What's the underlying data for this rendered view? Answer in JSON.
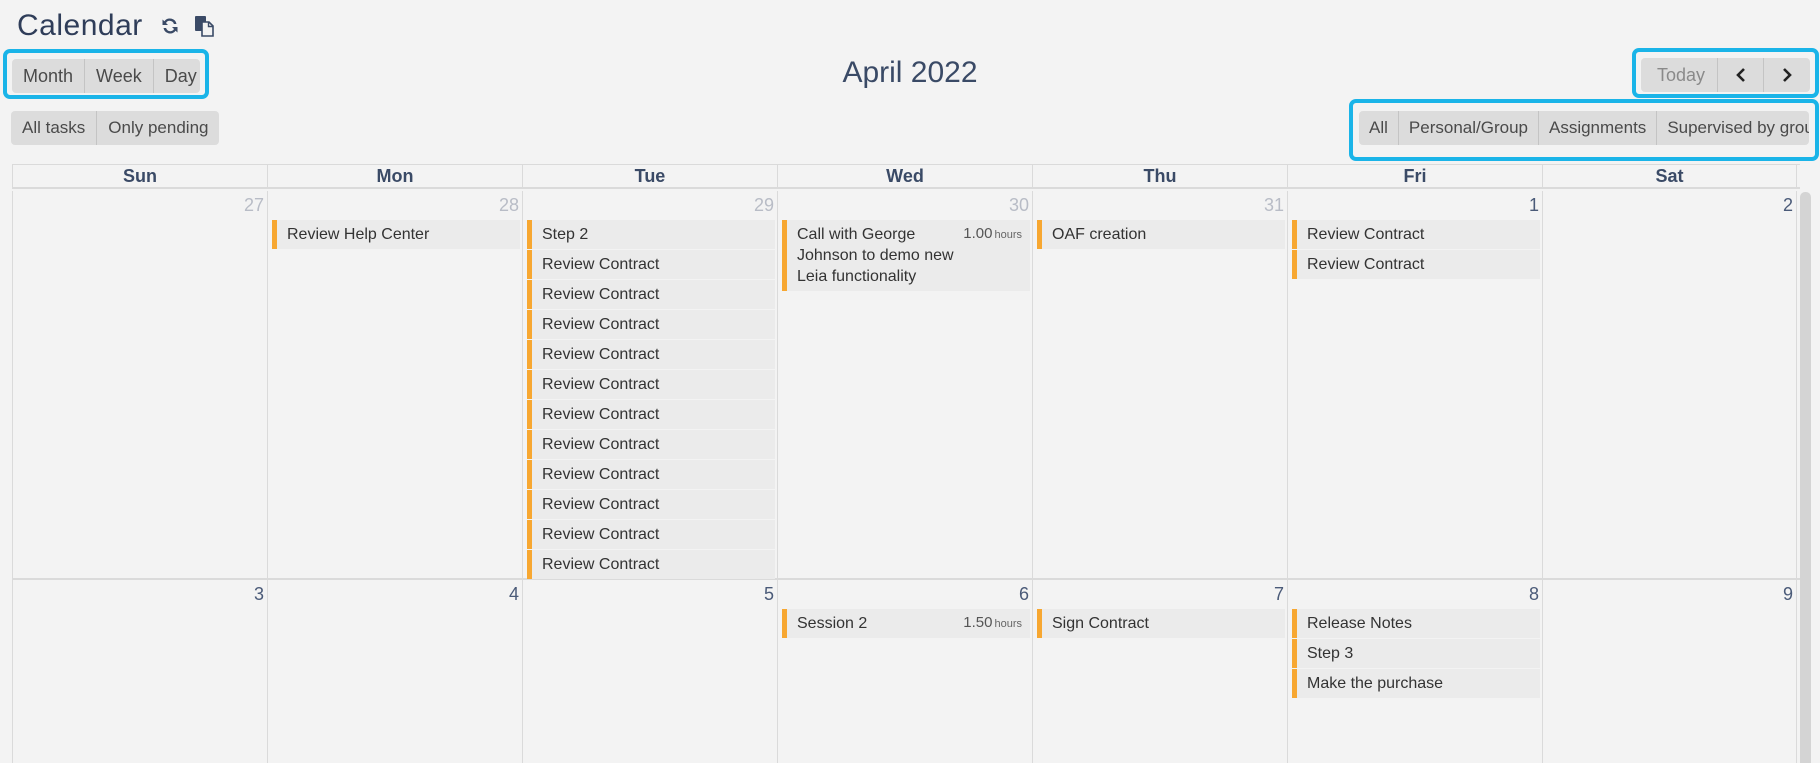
{
  "header": {
    "title": "Calendar",
    "icons": [
      "refresh-icon",
      "copy-icon"
    ],
    "month_label": "April 2022"
  },
  "view_switcher": {
    "month": "Month",
    "week": "Week",
    "day": "Day"
  },
  "task_filter": {
    "all": "All tasks",
    "pending": "Only pending"
  },
  "navigation": {
    "today": "Today",
    "prev": "‹",
    "next": "›"
  },
  "scope_filter": {
    "all": "All",
    "personal": "Personal/Group",
    "assignments": "Assignments",
    "supervised": "Supervised by group"
  },
  "accent_colors": {
    "event_bar": "#f7a731",
    "highlight": "#1ab4e8"
  },
  "grid": {
    "weekdays": [
      "Sun",
      "Mon",
      "Tue",
      "Wed",
      "Thu",
      "Fri",
      "Sat"
    ],
    "weeks": [
      {
        "days": [
          {
            "num": "27",
            "other": true,
            "events": []
          },
          {
            "num": "28",
            "other": true,
            "events": [
              {
                "title": "Review Help Center"
              }
            ]
          },
          {
            "num": "29",
            "other": true,
            "events": [
              {
                "title": "Step 2"
              },
              {
                "title": "Review Contract"
              },
              {
                "title": "Review Contract"
              },
              {
                "title": "Review Contract"
              },
              {
                "title": "Review Contract"
              },
              {
                "title": "Review Contract"
              },
              {
                "title": "Review Contract"
              },
              {
                "title": "Review Contract"
              },
              {
                "title": "Review Contract"
              },
              {
                "title": "Review Contract"
              },
              {
                "title": "Review Contract"
              },
              {
                "title": "Review Contract"
              }
            ]
          },
          {
            "num": "30",
            "other": true,
            "events": [
              {
                "title": "Call with George Johnson to demo new Leia functionality",
                "duration": "1.00",
                "unit": "hours"
              }
            ]
          },
          {
            "num": "31",
            "other": true,
            "events": [
              {
                "title": "OAF creation"
              }
            ]
          },
          {
            "num": "1",
            "other": false,
            "events": [
              {
                "title": "Review Contract"
              },
              {
                "title": "Review Contract"
              }
            ]
          },
          {
            "num": "2",
            "other": false,
            "events": []
          }
        ]
      },
      {
        "days": [
          {
            "num": "3",
            "other": false,
            "events": []
          },
          {
            "num": "4",
            "other": false,
            "events": []
          },
          {
            "num": "5",
            "other": false,
            "events": []
          },
          {
            "num": "6",
            "other": false,
            "events": [
              {
                "title": "Session 2",
                "duration": "1.50",
                "unit": "hours"
              }
            ]
          },
          {
            "num": "7",
            "other": false,
            "events": [
              {
                "title": "Sign Contract"
              }
            ]
          },
          {
            "num": "8",
            "other": false,
            "events": [
              {
                "title": "Release Notes"
              },
              {
                "title": "Step 3"
              },
              {
                "title": "Make the purchase"
              }
            ]
          },
          {
            "num": "9",
            "other": false,
            "events": []
          }
        ]
      }
    ]
  }
}
